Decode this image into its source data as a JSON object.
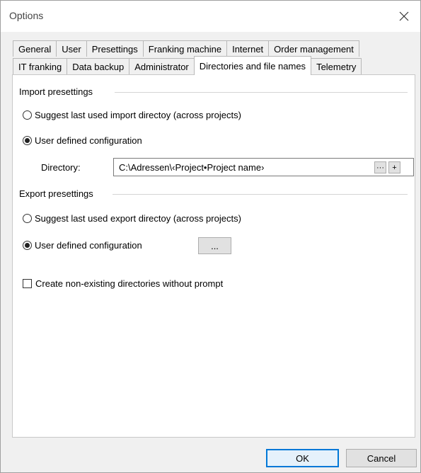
{
  "window": {
    "title": "Options",
    "close_icon": "close-icon"
  },
  "tabs_row1": [
    "General",
    "User",
    "Presettings",
    "Franking machine",
    "Internet",
    "Order management"
  ],
  "tabs_row2": [
    "IT franking",
    "Data backup",
    "Administrator",
    "Directories and file names",
    "Telemetry"
  ],
  "active_tab": "Directories and file names",
  "import": {
    "group_label": "Import presettings",
    "option_last": "Suggest last used import directoy (across projects)",
    "option_user": "User defined configuration",
    "selected": "user",
    "directory_label": "Directory:",
    "directory_value": "C:\\Adressen\\‹Project•Project name›",
    "browse_label": "···",
    "add_label": "+"
  },
  "export": {
    "group_label": "Export presettings",
    "option_last": "Suggest last used export directoy (across projects)",
    "option_user": "User defined configuration",
    "selected": "user",
    "config_button": "..."
  },
  "create_dirs": {
    "label": "Create non-existing directories without prompt",
    "checked": false
  },
  "buttons": {
    "ok": "OK",
    "cancel": "Cancel"
  },
  "colors": {
    "accent": "#0078d7",
    "dialog_bg": "#f0f0f0",
    "panel_bg": "#ffffff"
  }
}
